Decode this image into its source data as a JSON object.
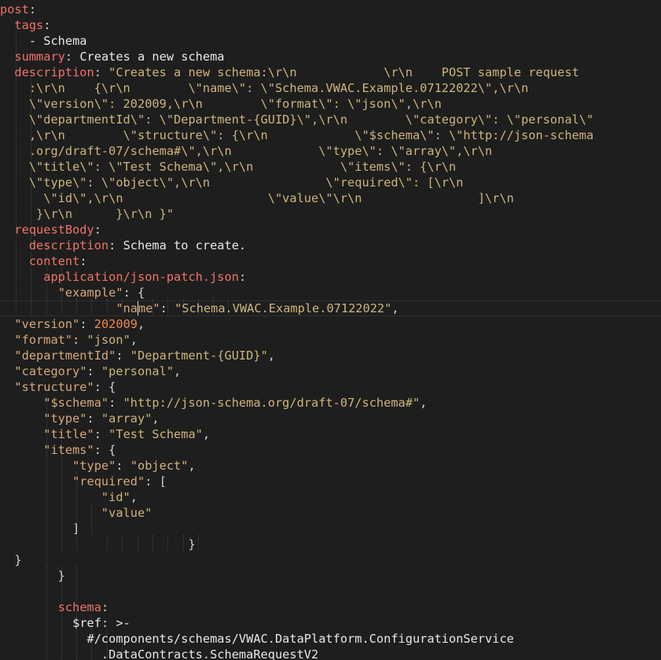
{
  "editor": {
    "lines": [
      {
        "parts": [
          [
            "k",
            "post"
          ],
          [
            "p",
            ":"
          ]
        ]
      },
      {
        "parts": [
          [
            "t",
            "  "
          ],
          [
            "k",
            "tags"
          ],
          [
            "p",
            ":"
          ]
        ]
      },
      {
        "parts": [
          [
            "t",
            "    - Schema"
          ]
        ]
      },
      {
        "parts": [
          [
            "t",
            "  "
          ],
          [
            "k",
            "summary"
          ],
          [
            "p",
            ": "
          ],
          [
            "t",
            "Creates a new schema"
          ]
        ]
      },
      {
        "parts": [
          [
            "t",
            "  "
          ],
          [
            "k",
            "description"
          ],
          [
            "p",
            ": "
          ],
          [
            "s",
            "\"Creates a new schema:\\r\\n            \\r\\n    POST sample request"
          ]
        ]
      },
      {
        "parts": [
          [
            "s",
            "    :\\r\\n    {\\r\\n        \\\"name\\\": \\\"Schema.VWAC.Example.07122022\\\",\\r\\n"
          ]
        ]
      },
      {
        "parts": [
          [
            "s",
            "    \\\"version\\\": 202009,\\r\\n        \\\"format\\\": \\\"json\\\",\\r\\n"
          ]
        ]
      },
      {
        "parts": [
          [
            "s",
            "    \\\"departmentId\\\": \\\"Department-{GUID}\\\",\\r\\n        \\\"category\\\": \\\"personal\\\""
          ]
        ]
      },
      {
        "parts": [
          [
            "s",
            "    ,\\r\\n        \\\"structure\\\": {\\r\\n            \\\"$schema\\\": \\\"http://json-schema"
          ]
        ]
      },
      {
        "parts": [
          [
            "s",
            "    .org/draft-07/schema#\\\",\\r\\n            \\\"type\\\": \\\"array\\\",\\r\\n"
          ]
        ]
      },
      {
        "parts": [
          [
            "s",
            "    \\\"title\\\": \\\"Test Schema\\\",\\r\\n            \\\"items\\\": {\\r\\n"
          ]
        ]
      },
      {
        "parts": [
          [
            "s",
            "    \\\"type\\\": \\\"object\\\",\\r\\n                \\\"required\\\": [\\r\\n"
          ]
        ]
      },
      {
        "parts": [
          [
            "s",
            "      \\\"id\\\",\\r\\n                    \\\"value\\\"\\r\\n                ]\\r\\n"
          ]
        ]
      },
      {
        "parts": [
          [
            "s",
            "     }\\r\\n      }\\r\\n }\""
          ]
        ]
      },
      {
        "parts": [
          [
            "t",
            "  "
          ],
          [
            "k",
            "requestBody"
          ],
          [
            "p",
            ":"
          ]
        ]
      },
      {
        "parts": [
          [
            "t",
            "    "
          ],
          [
            "k",
            "description"
          ],
          [
            "p",
            ": "
          ],
          [
            "t",
            "Schema to create."
          ]
        ]
      },
      {
        "parts": [
          [
            "t",
            "    "
          ],
          [
            "k",
            "content"
          ],
          [
            "p",
            ":"
          ]
        ]
      },
      {
        "parts": [
          [
            "t",
            "      "
          ],
          [
            "k",
            "application/json-patch.json"
          ],
          [
            "p",
            ":"
          ]
        ]
      },
      {
        "parts": [
          [
            "t",
            "        "
          ],
          [
            "jk",
            "\"example\""
          ],
          [
            "p",
            ": {"
          ]
        ]
      },
      {
        "current": true,
        "parts": [
          [
            "t",
            "                "
          ],
          [
            "jk",
            "\"na"
          ],
          [
            "cursor",
            ""
          ],
          [
            "jk",
            "me\""
          ],
          [
            "p",
            ": "
          ],
          [
            "s",
            "\"Schema.VWAC.Example.07122022\""
          ],
          [
            "p",
            ","
          ]
        ]
      },
      {
        "parts": [
          [
            "jk",
            "  \"version\""
          ],
          [
            "p",
            ": "
          ],
          [
            "n",
            "202009"
          ],
          [
            "p",
            ","
          ]
        ]
      },
      {
        "parts": [
          [
            "jk",
            "  \"format\""
          ],
          [
            "p",
            ": "
          ],
          [
            "s",
            "\"json\""
          ],
          [
            "p",
            ","
          ]
        ]
      },
      {
        "parts": [
          [
            "jk",
            "  \"departmentId\""
          ],
          [
            "p",
            ": "
          ],
          [
            "s",
            "\"Department-{GUID}\""
          ],
          [
            "p",
            ","
          ]
        ]
      },
      {
        "parts": [
          [
            "jk",
            "  \"category\""
          ],
          [
            "p",
            ": "
          ],
          [
            "s",
            "\"personal\""
          ],
          [
            "p",
            ","
          ]
        ]
      },
      {
        "parts": [
          [
            "jk",
            "  \"structure\""
          ],
          [
            "p",
            ": {"
          ]
        ]
      },
      {
        "parts": [
          [
            "jk",
            "      \"$schema\""
          ],
          [
            "p",
            ": "
          ],
          [
            "s",
            "\"http://json-schema.org/draft-07/schema#\""
          ],
          [
            "p",
            ","
          ]
        ]
      },
      {
        "parts": [
          [
            "jk",
            "      \"type\""
          ],
          [
            "p",
            ": "
          ],
          [
            "s",
            "\"array\""
          ],
          [
            "p",
            ","
          ]
        ]
      },
      {
        "parts": [
          [
            "jk",
            "      \"title\""
          ],
          [
            "p",
            ": "
          ],
          [
            "s",
            "\"Test Schema\""
          ],
          [
            "p",
            ","
          ]
        ]
      },
      {
        "parts": [
          [
            "jk",
            "      \"items\""
          ],
          [
            "p",
            ": {"
          ]
        ]
      },
      {
        "parts": [
          [
            "jk",
            "          \"type\""
          ],
          [
            "p",
            ": "
          ],
          [
            "s",
            "\"object\""
          ],
          [
            "p",
            ","
          ]
        ]
      },
      {
        "parts": [
          [
            "jk",
            "          \"required\""
          ],
          [
            "p",
            ": ["
          ]
        ]
      },
      {
        "parts": [
          [
            "s",
            "              \"id\""
          ],
          [
            "p",
            ","
          ]
        ]
      },
      {
        "parts": [
          [
            "s",
            "              \"value\""
          ]
        ]
      },
      {
        "parts": [
          [
            "p",
            "          ]"
          ]
        ]
      },
      {
        "parts": [
          [
            "p",
            "                          }"
          ]
        ]
      },
      {
        "parts": [
          [
            "p",
            "  }"
          ]
        ]
      },
      {
        "parts": [
          [
            "p",
            "        }"
          ]
        ]
      },
      {
        "parts": [
          [
            "t",
            ""
          ]
        ]
      },
      {
        "parts": [
          [
            "t",
            "        "
          ],
          [
            "k",
            "schema"
          ],
          [
            "p",
            ":"
          ]
        ]
      },
      {
        "parts": [
          [
            "t",
            "          "
          ],
          [
            "t",
            "$ref"
          ],
          [
            "p",
            ": "
          ],
          [
            "t",
            ">-"
          ]
        ]
      },
      {
        "parts": [
          [
            "t",
            "            #/components/schemas/VWAC.DataPlatform.ConfigurationService"
          ]
        ]
      },
      {
        "parts": [
          [
            "t",
            "              .DataContracts.SchemaRequestV2"
          ]
        ]
      }
    ]
  }
}
